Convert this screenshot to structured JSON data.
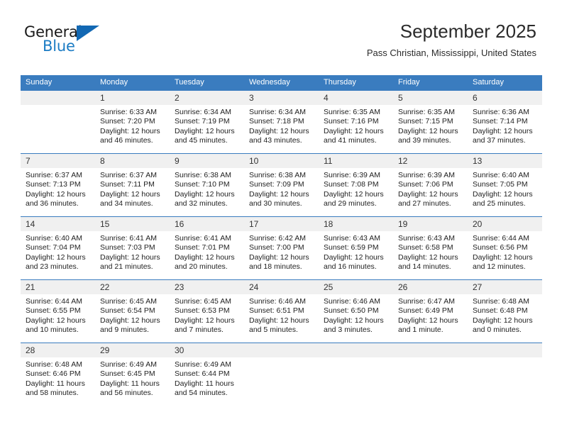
{
  "brand": {
    "name_primary": "General",
    "name_secondary": "Blue"
  },
  "header": {
    "title": "September 2025",
    "location": "Pass Christian, Mississippi, United States"
  },
  "calendar": {
    "weekday_headers": [
      "Sunday",
      "Monday",
      "Tuesday",
      "Wednesday",
      "Thursday",
      "Friday",
      "Saturday"
    ],
    "accent_color": "#3a7cbf",
    "daynum_band_color": "#f0f0f0",
    "weeks": [
      [
        {
          "day": "",
          "sunrise": "",
          "sunset": "",
          "daylight": ""
        },
        {
          "day": "1",
          "sunrise": "Sunrise: 6:33 AM",
          "sunset": "Sunset: 7:20 PM",
          "daylight": "Daylight: 12 hours and 46 minutes."
        },
        {
          "day": "2",
          "sunrise": "Sunrise: 6:34 AM",
          "sunset": "Sunset: 7:19 PM",
          "daylight": "Daylight: 12 hours and 45 minutes."
        },
        {
          "day": "3",
          "sunrise": "Sunrise: 6:34 AM",
          "sunset": "Sunset: 7:18 PM",
          "daylight": "Daylight: 12 hours and 43 minutes."
        },
        {
          "day": "4",
          "sunrise": "Sunrise: 6:35 AM",
          "sunset": "Sunset: 7:16 PM",
          "daylight": "Daylight: 12 hours and 41 minutes."
        },
        {
          "day": "5",
          "sunrise": "Sunrise: 6:35 AM",
          "sunset": "Sunset: 7:15 PM",
          "daylight": "Daylight: 12 hours and 39 minutes."
        },
        {
          "day": "6",
          "sunrise": "Sunrise: 6:36 AM",
          "sunset": "Sunset: 7:14 PM",
          "daylight": "Daylight: 12 hours and 37 minutes."
        }
      ],
      [
        {
          "day": "7",
          "sunrise": "Sunrise: 6:37 AM",
          "sunset": "Sunset: 7:13 PM",
          "daylight": "Daylight: 12 hours and 36 minutes."
        },
        {
          "day": "8",
          "sunrise": "Sunrise: 6:37 AM",
          "sunset": "Sunset: 7:11 PM",
          "daylight": "Daylight: 12 hours and 34 minutes."
        },
        {
          "day": "9",
          "sunrise": "Sunrise: 6:38 AM",
          "sunset": "Sunset: 7:10 PM",
          "daylight": "Daylight: 12 hours and 32 minutes."
        },
        {
          "day": "10",
          "sunrise": "Sunrise: 6:38 AM",
          "sunset": "Sunset: 7:09 PM",
          "daylight": "Daylight: 12 hours and 30 minutes."
        },
        {
          "day": "11",
          "sunrise": "Sunrise: 6:39 AM",
          "sunset": "Sunset: 7:08 PM",
          "daylight": "Daylight: 12 hours and 29 minutes."
        },
        {
          "day": "12",
          "sunrise": "Sunrise: 6:39 AM",
          "sunset": "Sunset: 7:06 PM",
          "daylight": "Daylight: 12 hours and 27 minutes."
        },
        {
          "day": "13",
          "sunrise": "Sunrise: 6:40 AM",
          "sunset": "Sunset: 7:05 PM",
          "daylight": "Daylight: 12 hours and 25 minutes."
        }
      ],
      [
        {
          "day": "14",
          "sunrise": "Sunrise: 6:40 AM",
          "sunset": "Sunset: 7:04 PM",
          "daylight": "Daylight: 12 hours and 23 minutes."
        },
        {
          "day": "15",
          "sunrise": "Sunrise: 6:41 AM",
          "sunset": "Sunset: 7:03 PM",
          "daylight": "Daylight: 12 hours and 21 minutes."
        },
        {
          "day": "16",
          "sunrise": "Sunrise: 6:41 AM",
          "sunset": "Sunset: 7:01 PM",
          "daylight": "Daylight: 12 hours and 20 minutes."
        },
        {
          "day": "17",
          "sunrise": "Sunrise: 6:42 AM",
          "sunset": "Sunset: 7:00 PM",
          "daylight": "Daylight: 12 hours and 18 minutes."
        },
        {
          "day": "18",
          "sunrise": "Sunrise: 6:43 AM",
          "sunset": "Sunset: 6:59 PM",
          "daylight": "Daylight: 12 hours and 16 minutes."
        },
        {
          "day": "19",
          "sunrise": "Sunrise: 6:43 AM",
          "sunset": "Sunset: 6:58 PM",
          "daylight": "Daylight: 12 hours and 14 minutes."
        },
        {
          "day": "20",
          "sunrise": "Sunrise: 6:44 AM",
          "sunset": "Sunset: 6:56 PM",
          "daylight": "Daylight: 12 hours and 12 minutes."
        }
      ],
      [
        {
          "day": "21",
          "sunrise": "Sunrise: 6:44 AM",
          "sunset": "Sunset: 6:55 PM",
          "daylight": "Daylight: 12 hours and 10 minutes."
        },
        {
          "day": "22",
          "sunrise": "Sunrise: 6:45 AM",
          "sunset": "Sunset: 6:54 PM",
          "daylight": "Daylight: 12 hours and 9 minutes."
        },
        {
          "day": "23",
          "sunrise": "Sunrise: 6:45 AM",
          "sunset": "Sunset: 6:53 PM",
          "daylight": "Daylight: 12 hours and 7 minutes."
        },
        {
          "day": "24",
          "sunrise": "Sunrise: 6:46 AM",
          "sunset": "Sunset: 6:51 PM",
          "daylight": "Daylight: 12 hours and 5 minutes."
        },
        {
          "day": "25",
          "sunrise": "Sunrise: 6:46 AM",
          "sunset": "Sunset: 6:50 PM",
          "daylight": "Daylight: 12 hours and 3 minutes."
        },
        {
          "day": "26",
          "sunrise": "Sunrise: 6:47 AM",
          "sunset": "Sunset: 6:49 PM",
          "daylight": "Daylight: 12 hours and 1 minute."
        },
        {
          "day": "27",
          "sunrise": "Sunrise: 6:48 AM",
          "sunset": "Sunset: 6:48 PM",
          "daylight": "Daylight: 12 hours and 0 minutes."
        }
      ],
      [
        {
          "day": "28",
          "sunrise": "Sunrise: 6:48 AM",
          "sunset": "Sunset: 6:46 PM",
          "daylight": "Daylight: 11 hours and 58 minutes."
        },
        {
          "day": "29",
          "sunrise": "Sunrise: 6:49 AM",
          "sunset": "Sunset: 6:45 PM",
          "daylight": "Daylight: 11 hours and 56 minutes."
        },
        {
          "day": "30",
          "sunrise": "Sunrise: 6:49 AM",
          "sunset": "Sunset: 6:44 PM",
          "daylight": "Daylight: 11 hours and 54 minutes."
        },
        {
          "day": "",
          "sunrise": "",
          "sunset": "",
          "daylight": ""
        },
        {
          "day": "",
          "sunrise": "",
          "sunset": "",
          "daylight": ""
        },
        {
          "day": "",
          "sunrise": "",
          "sunset": "",
          "daylight": ""
        },
        {
          "day": "",
          "sunrise": "",
          "sunset": "",
          "daylight": ""
        }
      ]
    ]
  }
}
